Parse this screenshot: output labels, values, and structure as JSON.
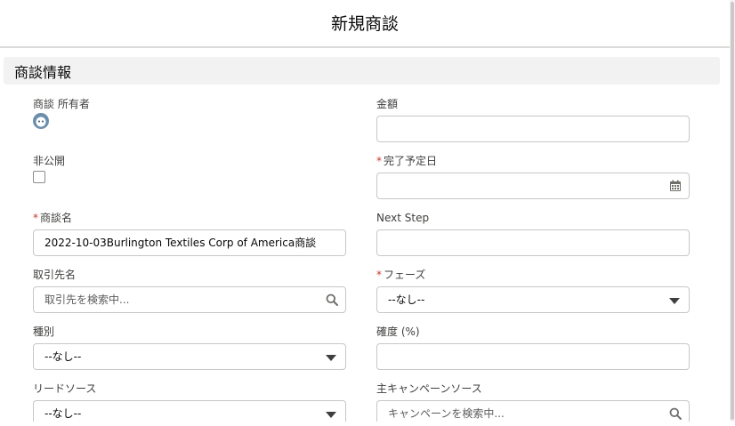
{
  "modal": {
    "title": "新規商談"
  },
  "section": {
    "title": "商談情報"
  },
  "fields": {
    "owner": {
      "label": "商談 所有者"
    },
    "amount": {
      "label": "金額",
      "value": ""
    },
    "private": {
      "label": "非公開"
    },
    "close_date": {
      "label": "完了予定日",
      "required_mark": "*",
      "value": ""
    },
    "opportunity_name": {
      "label": "商談名",
      "required_mark": "*",
      "value": "2022-10-03Burlington Textiles Corp of America商談"
    },
    "next_step": {
      "label": "Next Step",
      "value": ""
    },
    "account_name": {
      "label": "取引先名",
      "placeholder": "取引先を検索中..."
    },
    "stage": {
      "label": "フェーズ",
      "required_mark": "*",
      "value": "--なし--"
    },
    "type": {
      "label": "種別",
      "value": "--なし--"
    },
    "probability": {
      "label": "確度 (%)",
      "value": ""
    },
    "lead_source": {
      "label": "リードソース",
      "value": "--なし--"
    },
    "primary_campaign": {
      "label": "主キャンペーンソース",
      "placeholder": "キャンペーンを検索中..."
    }
  },
  "icons": {
    "owner_avatar": "avatar-icon",
    "calendar": "calendar-icon",
    "search": "search-icon",
    "dropdown": "chevron-down-icon"
  },
  "colors": {
    "required": "#c23934",
    "border": "#c9c7c5",
    "section_bg": "#f3f2f2",
    "avatar": "#6b8ead"
  }
}
